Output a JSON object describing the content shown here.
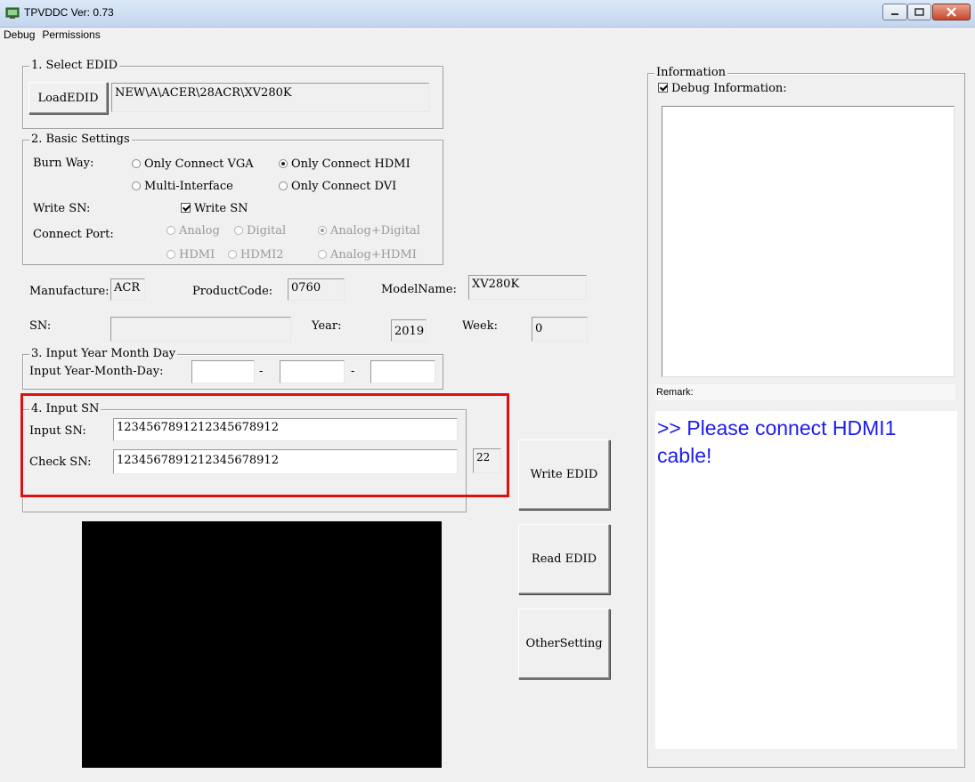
{
  "window": {
    "title": "TPVDDC  Ver: 0.73"
  },
  "menu": [
    "Debug",
    "Permissions"
  ],
  "select_edid": {
    "title": "1. Select EDID",
    "load_button": "LoadEDID",
    "path": "NEW\\A\\ACER\\28ACR\\XV280K"
  },
  "basic": {
    "title": "2. Basic Settings",
    "burn_way_label": "Burn Way:",
    "burn_opts": [
      "Only Connect VGA",
      "Only Connect HDMI",
      "Multi-Interface",
      "Only Connect DVI"
    ],
    "burn_selected": "Only Connect HDMI",
    "write_sn_label": "Write SN:",
    "write_sn_check": "Write SN",
    "write_sn_checked": true,
    "connect_port_label": "Connect Port:",
    "port_opts": [
      "Analog",
      "Digital",
      "Analog+Digital",
      "HDMI",
      "HDMI2",
      "Analog+HDMI"
    ],
    "port_selected": "Analog+Digital"
  },
  "info_fields": {
    "manufacture_label": "Manufacture:",
    "manufacture": "ACR",
    "product_code_label": "ProductCode:",
    "product_code": "0760",
    "model_name_label": "ModelName:",
    "model_name": "XV280K",
    "sn_label": "SN:",
    "sn": "",
    "year_label": "Year:",
    "year": "2019",
    "week_label": "Week:",
    "week": "0"
  },
  "input_date": {
    "title": "3. Input Year Month Day",
    "label": "Input Year-Month-Day:",
    "sep": "-"
  },
  "input_sn": {
    "title": "4. Input SN",
    "input_label": "Input SN:",
    "input_value": "1234567891212345678912",
    "check_label": "Check SN:",
    "check_value": "1234567891212345678912",
    "length": "22"
  },
  "buttons": {
    "write": "Write EDID",
    "read": "Read EDID",
    "other": "OtherSetting"
  },
  "information": {
    "title": "Information",
    "debug_check": "Debug Information:",
    "debug_checked": true,
    "remark_label": "Remark:",
    "message": ">> Please connect HDMI1 cable!"
  },
  "colors": {
    "highlight": "#e01010",
    "message": "#1c1cf0"
  }
}
